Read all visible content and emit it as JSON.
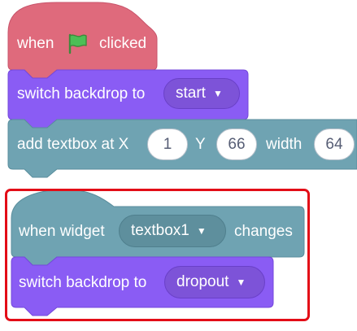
{
  "script_top": {
    "hat": {
      "prefix": "when",
      "flag_icon": "green-flag-icon",
      "suffix": "clicked",
      "color": "#df6a7c"
    },
    "switch_block": {
      "label": "switch backdrop to",
      "dropdown_value": "start",
      "color": "#8a5cf4"
    },
    "add_textbox": {
      "label": "add textbox at X",
      "x_value": "1",
      "y_label": "Y",
      "y_value": "66",
      "width_label": "width",
      "width_value": "64",
      "color": "#6fa3b2"
    }
  },
  "script_bottom": {
    "hat": {
      "prefix": "when widget",
      "dropdown_value": "textbox1",
      "suffix": "changes",
      "color": "#6fa3b2"
    },
    "switch_block": {
      "label": "switch backdrop to",
      "dropdown_value": "dropout",
      "color": "#8a5cf4"
    },
    "highlight_color": "#e30d17"
  }
}
